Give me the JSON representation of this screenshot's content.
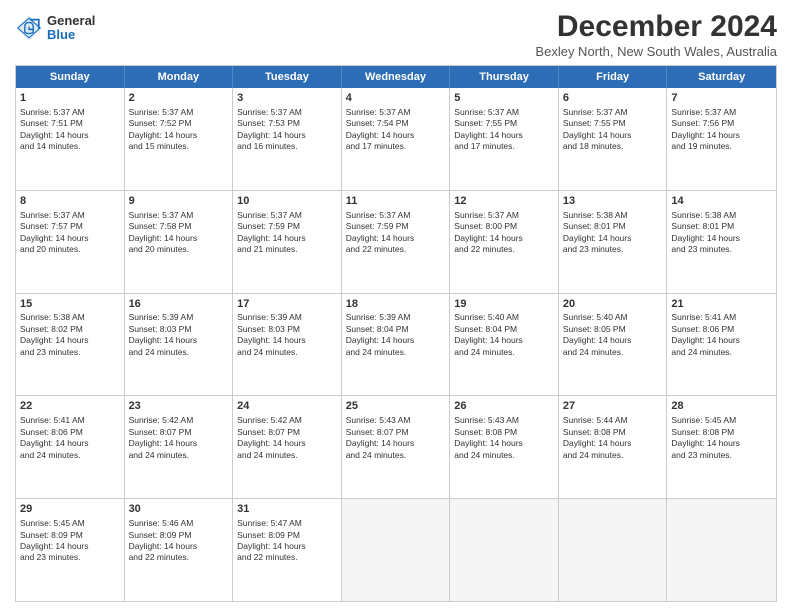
{
  "header": {
    "logo_general": "General",
    "logo_blue": "Blue",
    "month_title": "December 2024",
    "location": "Bexley North, New South Wales, Australia"
  },
  "days_of_week": [
    "Sunday",
    "Monday",
    "Tuesday",
    "Wednesday",
    "Thursday",
    "Friday",
    "Saturday"
  ],
  "weeks": [
    [
      {
        "num": "1",
        "lines": [
          "Sunrise: 5:37 AM",
          "Sunset: 7:51 PM",
          "Daylight: 14 hours",
          "and 14 minutes."
        ]
      },
      {
        "num": "2",
        "lines": [
          "Sunrise: 5:37 AM",
          "Sunset: 7:52 PM",
          "Daylight: 14 hours",
          "and 15 minutes."
        ]
      },
      {
        "num": "3",
        "lines": [
          "Sunrise: 5:37 AM",
          "Sunset: 7:53 PM",
          "Daylight: 14 hours",
          "and 16 minutes."
        ]
      },
      {
        "num": "4",
        "lines": [
          "Sunrise: 5:37 AM",
          "Sunset: 7:54 PM",
          "Daylight: 14 hours",
          "and 17 minutes."
        ]
      },
      {
        "num": "5",
        "lines": [
          "Sunrise: 5:37 AM",
          "Sunset: 7:55 PM",
          "Daylight: 14 hours",
          "and 17 minutes."
        ]
      },
      {
        "num": "6",
        "lines": [
          "Sunrise: 5:37 AM",
          "Sunset: 7:55 PM",
          "Daylight: 14 hours",
          "and 18 minutes."
        ]
      },
      {
        "num": "7",
        "lines": [
          "Sunrise: 5:37 AM",
          "Sunset: 7:56 PM",
          "Daylight: 14 hours",
          "and 19 minutes."
        ]
      }
    ],
    [
      {
        "num": "8",
        "lines": [
          "Sunrise: 5:37 AM",
          "Sunset: 7:57 PM",
          "Daylight: 14 hours",
          "and 20 minutes."
        ]
      },
      {
        "num": "9",
        "lines": [
          "Sunrise: 5:37 AM",
          "Sunset: 7:58 PM",
          "Daylight: 14 hours",
          "and 20 minutes."
        ]
      },
      {
        "num": "10",
        "lines": [
          "Sunrise: 5:37 AM",
          "Sunset: 7:59 PM",
          "Daylight: 14 hours",
          "and 21 minutes."
        ]
      },
      {
        "num": "11",
        "lines": [
          "Sunrise: 5:37 AM",
          "Sunset: 7:59 PM",
          "Daylight: 14 hours",
          "and 22 minutes."
        ]
      },
      {
        "num": "12",
        "lines": [
          "Sunrise: 5:37 AM",
          "Sunset: 8:00 PM",
          "Daylight: 14 hours",
          "and 22 minutes."
        ]
      },
      {
        "num": "13",
        "lines": [
          "Sunrise: 5:38 AM",
          "Sunset: 8:01 PM",
          "Daylight: 14 hours",
          "and 23 minutes."
        ]
      },
      {
        "num": "14",
        "lines": [
          "Sunrise: 5:38 AM",
          "Sunset: 8:01 PM",
          "Daylight: 14 hours",
          "and 23 minutes."
        ]
      }
    ],
    [
      {
        "num": "15",
        "lines": [
          "Sunrise: 5:38 AM",
          "Sunset: 8:02 PM",
          "Daylight: 14 hours",
          "and 23 minutes."
        ]
      },
      {
        "num": "16",
        "lines": [
          "Sunrise: 5:39 AM",
          "Sunset: 8:03 PM",
          "Daylight: 14 hours",
          "and 24 minutes."
        ]
      },
      {
        "num": "17",
        "lines": [
          "Sunrise: 5:39 AM",
          "Sunset: 8:03 PM",
          "Daylight: 14 hours",
          "and 24 minutes."
        ]
      },
      {
        "num": "18",
        "lines": [
          "Sunrise: 5:39 AM",
          "Sunset: 8:04 PM",
          "Daylight: 14 hours",
          "and 24 minutes."
        ]
      },
      {
        "num": "19",
        "lines": [
          "Sunrise: 5:40 AM",
          "Sunset: 8:04 PM",
          "Daylight: 14 hours",
          "and 24 minutes."
        ]
      },
      {
        "num": "20",
        "lines": [
          "Sunrise: 5:40 AM",
          "Sunset: 8:05 PM",
          "Daylight: 14 hours",
          "and 24 minutes."
        ]
      },
      {
        "num": "21",
        "lines": [
          "Sunrise: 5:41 AM",
          "Sunset: 8:06 PM",
          "Daylight: 14 hours",
          "and 24 minutes."
        ]
      }
    ],
    [
      {
        "num": "22",
        "lines": [
          "Sunrise: 5:41 AM",
          "Sunset: 8:06 PM",
          "Daylight: 14 hours",
          "and 24 minutes."
        ]
      },
      {
        "num": "23",
        "lines": [
          "Sunrise: 5:42 AM",
          "Sunset: 8:07 PM",
          "Daylight: 14 hours",
          "and 24 minutes."
        ]
      },
      {
        "num": "24",
        "lines": [
          "Sunrise: 5:42 AM",
          "Sunset: 8:07 PM",
          "Daylight: 14 hours",
          "and 24 minutes."
        ]
      },
      {
        "num": "25",
        "lines": [
          "Sunrise: 5:43 AM",
          "Sunset: 8:07 PM",
          "Daylight: 14 hours",
          "and 24 minutes."
        ]
      },
      {
        "num": "26",
        "lines": [
          "Sunrise: 5:43 AM",
          "Sunset: 8:08 PM",
          "Daylight: 14 hours",
          "and 24 minutes."
        ]
      },
      {
        "num": "27",
        "lines": [
          "Sunrise: 5:44 AM",
          "Sunset: 8:08 PM",
          "Daylight: 14 hours",
          "and 24 minutes."
        ]
      },
      {
        "num": "28",
        "lines": [
          "Sunrise: 5:45 AM",
          "Sunset: 8:08 PM",
          "Daylight: 14 hours",
          "and 23 minutes."
        ]
      }
    ],
    [
      {
        "num": "29",
        "lines": [
          "Sunrise: 5:45 AM",
          "Sunset: 8:09 PM",
          "Daylight: 14 hours",
          "and 23 minutes."
        ]
      },
      {
        "num": "30",
        "lines": [
          "Sunrise: 5:46 AM",
          "Sunset: 8:09 PM",
          "Daylight: 14 hours",
          "and 22 minutes."
        ]
      },
      {
        "num": "31",
        "lines": [
          "Sunrise: 5:47 AM",
          "Sunset: 8:09 PM",
          "Daylight: 14 hours",
          "and 22 minutes."
        ]
      },
      null,
      null,
      null,
      null
    ]
  ]
}
